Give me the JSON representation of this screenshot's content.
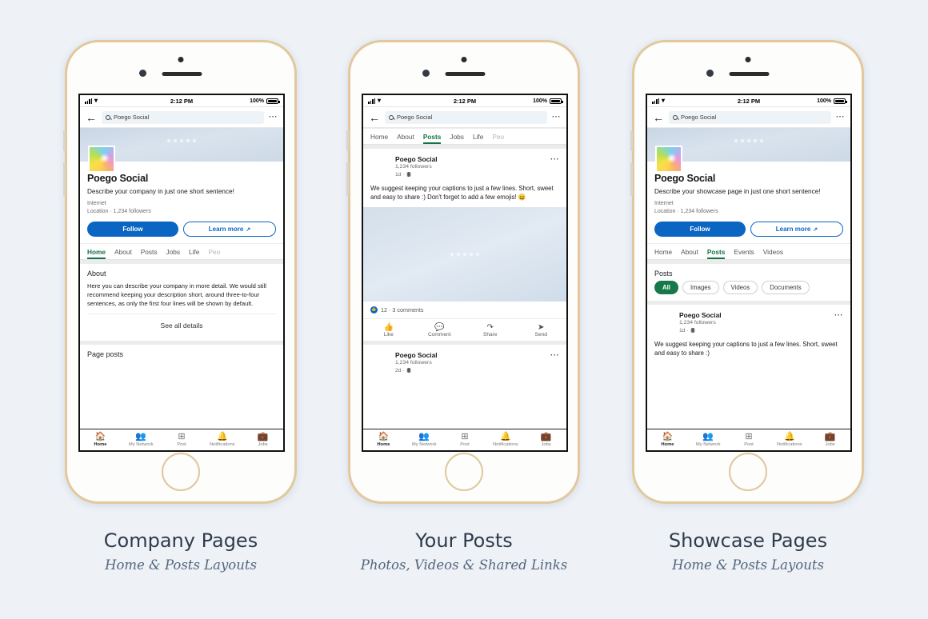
{
  "background_color": "#eef2f7",
  "accent_colors": {
    "linkedin_blue": "#0a66c2",
    "tab_green": "#157347",
    "chip_green": "#16794a",
    "frame_gold": "#e3c89d"
  },
  "status_bar": {
    "time": "2:12 PM",
    "battery": "100%"
  },
  "nav": {
    "back_icon": "arrow-left-icon",
    "search_value": "Poego Social",
    "search_icon": "search-icon",
    "more_icon": "more-horizontal-icon"
  },
  "bottom_nav": [
    {
      "label": "Home",
      "icon": "home-icon",
      "active": true
    },
    {
      "label": "My Network",
      "icon": "people-icon",
      "active": false
    },
    {
      "label": "Post",
      "icon": "plus-square-icon",
      "active": false
    },
    {
      "label": "Notifications",
      "icon": "bell-icon",
      "active": false
    },
    {
      "label": "Jobs",
      "icon": "briefcase-icon",
      "active": false
    }
  ],
  "phone1": {
    "page_name": "Poego Social",
    "description": "Describe your company in just one short sentence!",
    "industry": "Internet",
    "meta": "Location · 1,234 followers",
    "follow_label": "Follow",
    "learn_more_label": "Learn more",
    "tabs": [
      {
        "label": "Home",
        "active": true
      },
      {
        "label": "About",
        "active": false
      },
      {
        "label": "Posts",
        "active": false
      },
      {
        "label": "Jobs",
        "active": false
      },
      {
        "label": "Life",
        "active": false
      },
      {
        "label": "Peo",
        "active": false,
        "faded": true
      }
    ],
    "about_title": "About",
    "about_body": "Here you can describe your company in more detail. We would still recommend keeping your description short, around three-to-four sentences, as only the first four lines will be shown by default.",
    "see_all_label": "See all details",
    "page_posts_label": "Page posts"
  },
  "phone2": {
    "tabs": [
      {
        "label": "Home",
        "active": false
      },
      {
        "label": "About",
        "active": false
      },
      {
        "label": "Posts",
        "active": true
      },
      {
        "label": "Jobs",
        "active": false
      },
      {
        "label": "Life",
        "active": false
      },
      {
        "label": "Peo",
        "active": false,
        "faded": true
      }
    ],
    "post1": {
      "author": "Poego Social",
      "followers": "1,234 followers",
      "time": "1d ·",
      "text": "We suggest keeping your captions to just a few lines. Short, sweet and easy to share :) Don't forget to add a few emojis! 😄",
      "stats": "12 · 3 comments"
    },
    "post_actions": [
      {
        "label": "Like",
        "icon": "thumbs-up-icon"
      },
      {
        "label": "Comment",
        "icon": "comment-icon"
      },
      {
        "label": "Share",
        "icon": "share-icon"
      },
      {
        "label": "Send",
        "icon": "send-icon"
      }
    ],
    "post2": {
      "author": "Poego Social",
      "followers": "1,234 followers",
      "time": "2d ·"
    }
  },
  "phone3": {
    "page_name": "Poego Social",
    "description": "Describe your showcase page in just one short sentence!",
    "industry": "Internet",
    "meta": "Location · 1,234 followers",
    "follow_label": "Follow",
    "learn_more_label": "Learn more",
    "tabs": [
      {
        "label": "Home",
        "active": false
      },
      {
        "label": "About",
        "active": false
      },
      {
        "label": "Posts",
        "active": true
      },
      {
        "label": "Events",
        "active": false
      },
      {
        "label": "Videos",
        "active": false
      }
    ],
    "posts_title": "Posts",
    "filters": [
      {
        "label": "All",
        "active": true
      },
      {
        "label": "Images",
        "active": false
      },
      {
        "label": "Videos",
        "active": false
      },
      {
        "label": "Documents",
        "active": false
      }
    ],
    "post": {
      "author": "Poego Social",
      "followers": "1,234 followers",
      "time": "1d ·",
      "text": "We suggest keeping your captions to just a few lines. Short, sweet and easy to share :)"
    }
  },
  "captions": [
    {
      "title": "Company Pages",
      "subtitle": "Home & Posts Layouts"
    },
    {
      "title": "Your Posts",
      "subtitle": "Photos, Videos & Shared Links"
    },
    {
      "title": "Showcase Pages",
      "subtitle": "Home & Posts Layouts"
    }
  ]
}
